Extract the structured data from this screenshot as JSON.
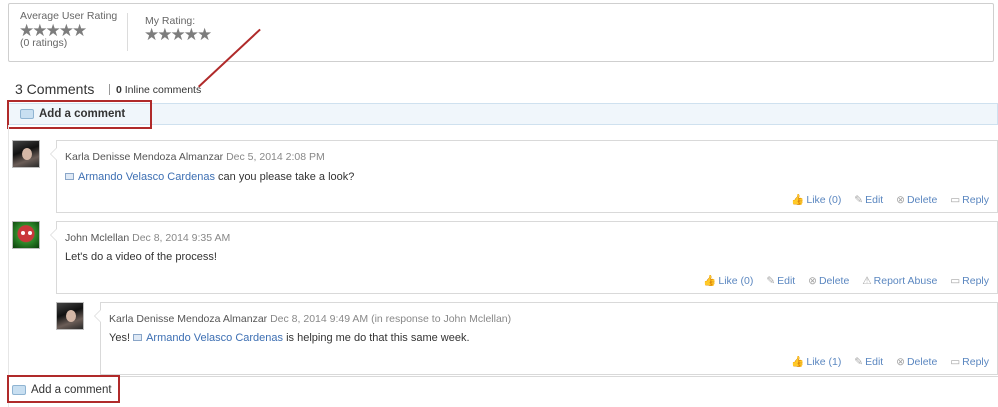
{
  "rating": {
    "average_label": "Average User Rating",
    "average_sub": "(0 ratings)",
    "my_label": "My Rating:",
    "stars": "★★★★★"
  },
  "comments_header": {
    "count_title": "3 Comments",
    "inline_count": "0",
    "inline_label": "Inline comments"
  },
  "add_comment_label": "Add a comment",
  "comments": [
    {
      "author": "Karla Denisse Mendoza Almanzar",
      "date": "Dec 5, 2014 2:08 PM",
      "mention": "Armando Velasco Cardenas",
      "text_after": " can you please take a look?",
      "actions": {
        "like": "Like (0)",
        "edit": "Edit",
        "delete": "Delete",
        "reply": "Reply"
      }
    },
    {
      "author": "John Mclellan",
      "date": "Dec 8, 2014 9:35 AM",
      "text": "Let's do a video of the process!",
      "actions": {
        "like": "Like (0)",
        "edit": "Edit",
        "delete": "Delete",
        "report": "Report Abuse",
        "reply": "Reply"
      }
    },
    {
      "author": "Karla Denisse Mendoza Almanzar",
      "date": "Dec 8, 2014 9:49 AM (in response to John Mclellan)",
      "text_before": "Yes! ",
      "mention": "Armando Velasco Cardenas",
      "text_after": " is helping me do that this same week.",
      "actions": {
        "like": "Like (1)",
        "edit": "Edit",
        "delete": "Delete",
        "reply": "Reply"
      }
    }
  ],
  "colors": {
    "annotation_red": "#b02a2a",
    "link_blue": "#3d6fb3",
    "add_bar_bg": "#f0f6fb"
  }
}
